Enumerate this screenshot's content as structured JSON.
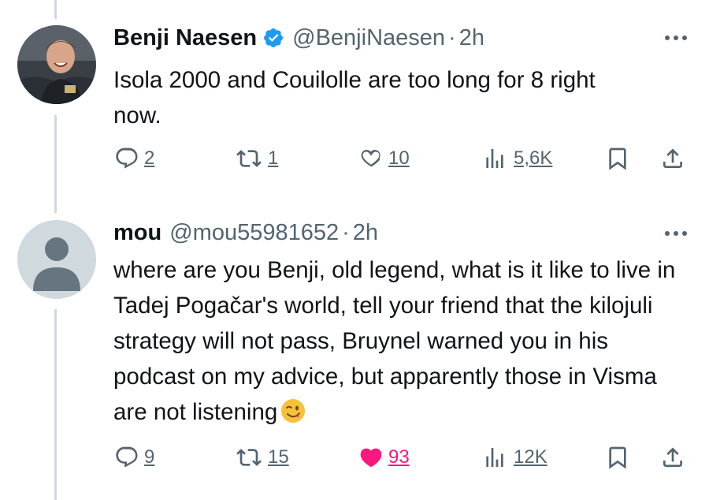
{
  "tweets": [
    {
      "author_name": "Benji Naesen",
      "verified": true,
      "handle": "@BenjiNaesen",
      "separator": "·",
      "time": "2h",
      "text": "Isola 2000 and Couilolle are too long for 8 right now.",
      "replies": "2",
      "retweets": "1",
      "likes": "10",
      "views": "5,6K",
      "liked": false
    },
    {
      "author_name": "mou",
      "verified": false,
      "handle": "@mou55981652",
      "separator": "·",
      "time": "2h",
      "text": "where are you Benji, old legend, what is it like to live in Tadej Pogačar's world, tell your friend that the kilojuli strategy will not pass, Bruynel warned you in his podcast on my advice, but apparently those in Visma are not listening",
      "emoji": "winking-face",
      "replies": "9",
      "retweets": "15",
      "likes": "93",
      "views": "12K",
      "liked": true
    }
  ],
  "colors": {
    "text": "#0f1419",
    "secondary": "#536471",
    "verified": "#1d9bf0",
    "like_active": "#f91880",
    "thread_line": "#cfd9de",
    "default_avatar_bg": "#cfd9de",
    "default_avatar_fg": "#66757f"
  }
}
